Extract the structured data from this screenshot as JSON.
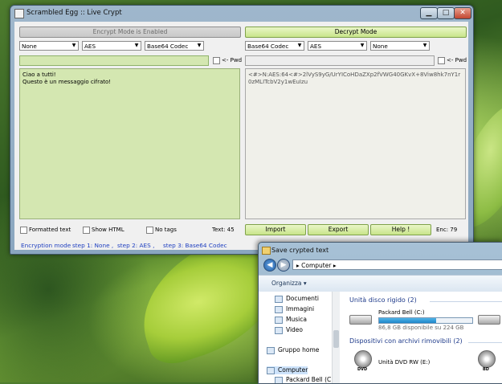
{
  "window": {
    "title": "Scrambled Egg :: Live Crypt",
    "minimize": "▁",
    "maximize": "□",
    "close": "✕"
  },
  "left": {
    "mode_button": "Encrypt Mode is Enabled",
    "combo1": "None",
    "combo2": "AES",
    "combo3": "Base64 Codec",
    "pwd_label": "<- Pwd",
    "text_line1": "Ciao a tutti!",
    "text_line2": "Questo è un messaggio cifrato!",
    "formatted_label": "Formatted text",
    "showhtml_label": "Show HTML",
    "notags_label": "No tags",
    "count": "Text: 45"
  },
  "right": {
    "mode_button": "Decrypt Mode",
    "combo1": "Base64 Codec",
    "combo2": "AES",
    "combo3": "None",
    "pwd_label": "<- Pwd",
    "cipher_text": "<#>N:AES:64<#>2lVyS9yG/UrYICoHDaZXp2fVWG40GKvX+8Viw8hk7nY1r0zMLITcbV2y1wEuIzu",
    "import": "Import",
    "export": "Export",
    "help": "Help !",
    "count": "Enc: 79"
  },
  "status": {
    "mode": "Encryption mode",
    "step1": "step 1: None ,",
    "step2": "step 2: AES ,",
    "step3": "step 3: Base64 Codec"
  },
  "dialog": {
    "title": "Save crypted text",
    "address": "▸  Computer  ▸",
    "organize": "Organizza ▾",
    "nav_items": [
      "Documenti",
      "Immagini",
      "Musica",
      "Video",
      "Gruppo home",
      "Computer",
      "Packard Bell (C:)"
    ],
    "section_hdd": "Unità disco rigido (2)",
    "drive_c_name": "Packard Bell (C:)",
    "drive_c_free": "86,8 GB disponibile su 224 GB",
    "drive_c_used": 0.61,
    "section_removable": "Dispositivi con archivi rimovibili (2)",
    "dvd_name": "Unità DVD RW (E:)",
    "dvd_label": "DVD",
    "bd_label": "BD"
  }
}
